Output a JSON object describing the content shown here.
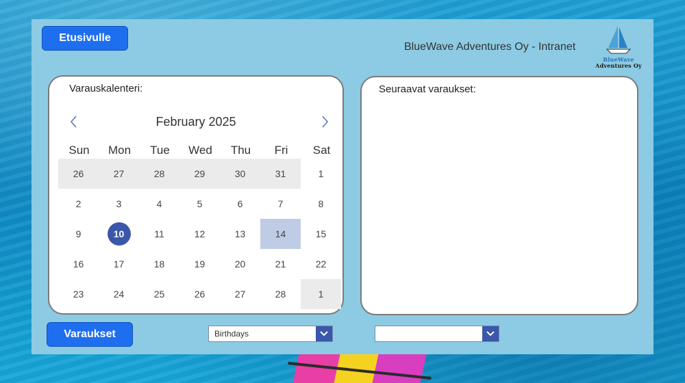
{
  "header": {
    "home_button": "Etusivulle",
    "title": "BlueWave Adventures Oy - Intranet",
    "logo_line1": "BlueWave",
    "logo_line2": "Adventures Oy"
  },
  "calendar": {
    "label": "Varauskalenteri:",
    "month": "February 2025",
    "weekdays": [
      "Sun",
      "Mon",
      "Tue",
      "Wed",
      "Thu",
      "Fri",
      "Sat"
    ],
    "weeks": [
      [
        "26",
        "27",
        "28",
        "29",
        "30",
        "31",
        "1"
      ],
      [
        "2",
        "3",
        "4",
        "5",
        "6",
        "7",
        "8"
      ],
      [
        "9",
        "10",
        "11",
        "12",
        "13",
        "14",
        "15"
      ],
      [
        "16",
        "17",
        "18",
        "19",
        "20",
        "21",
        "22"
      ],
      [
        "23",
        "24",
        "25",
        "26",
        "27",
        "28",
        "1"
      ]
    ],
    "selected_day": "10",
    "highlighted_day": "14"
  },
  "reservations": {
    "label": "Seuraavat varaukset:"
  },
  "footer": {
    "reservations_button": "Varaukset",
    "dropdown1_value": "Birthdays",
    "dropdown2_value": ""
  },
  "colors": {
    "accent": "#1e6ff0",
    "panel_background": "#8ccbe3",
    "today": "#3b57a9",
    "highlight": "#c0cce6",
    "other_month": "#ebebeb"
  }
}
